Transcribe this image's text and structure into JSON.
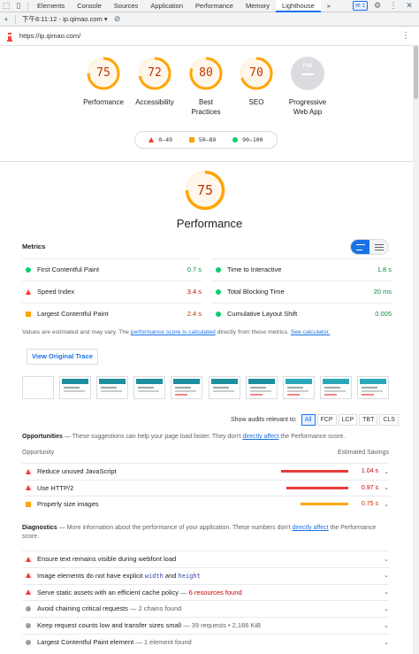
{
  "devtools": {
    "tabs": [
      "Elements",
      "Console",
      "Sources",
      "Application",
      "Performance",
      "Memory",
      "Lighthouse"
    ],
    "more": "»",
    "issues_count": "1",
    "report_selector": "下午8:11:12 - ip.qimao.com",
    "url": "https://ip.qimao.com/"
  },
  "categories": [
    {
      "score": "75",
      "label": "Performance",
      "fraction": 0.75,
      "color": "#ffa400"
    },
    {
      "score": "72",
      "label": "Accessibility",
      "fraction": 0.72,
      "color": "#ffa400"
    },
    {
      "score": "80",
      "label": "Best Practices",
      "fraction": 0.8,
      "color": "#ffa400"
    },
    {
      "score": "70",
      "label": "SEO",
      "fraction": 0.7,
      "color": "#ffa400"
    },
    {
      "score": "PWA",
      "label": "Progressive Web App",
      "fraction": 0,
      "color": "#bdbdbd"
    }
  ],
  "legend": {
    "fail": "0–49",
    "average": "50–89",
    "pass": "90–100"
  },
  "performance": {
    "score": "75",
    "fraction": 0.75,
    "title": "Performance"
  },
  "metrics_label": "Metrics",
  "metrics": [
    {
      "name": "First Contentful Paint",
      "value": "0.7 s",
      "status": "pass"
    },
    {
      "name": "Time to Interactive",
      "value": "1.8 s",
      "status": "pass"
    },
    {
      "name": "Speed Index",
      "value": "3.4 s",
      "status": "fail"
    },
    {
      "name": "Total Blocking Time",
      "value": "20 ms",
      "status": "pass"
    },
    {
      "name": "Largest Contentful Paint",
      "value": "2.4 s",
      "status": "average"
    },
    {
      "name": "Cumulative Layout Shift",
      "value": "0.005",
      "status": "pass"
    }
  ],
  "note": {
    "prefix": "Values are estimated and may vary. The ",
    "link1": "performance score is calculated",
    "middle": " directly from these metrics. ",
    "link2": "See calculator."
  },
  "view_trace": "View Original Trace",
  "filter": {
    "label": "Show audits relevant to:",
    "chips": [
      "All",
      "FCP",
      "LCP",
      "TBT",
      "CLS"
    ]
  },
  "opportunities": {
    "title": "Opportunities",
    "desc": " — These suggestions can help your page load faster. They don't ",
    "link": "directly affect",
    "desc2": " the Performance score.",
    "col_left": "Opportunity",
    "col_right": "Estimated Savings",
    "items": [
      {
        "title": "Reduce unused JavaScript",
        "savings": "1.04 s",
        "fraction": 0.95,
        "status": "fail"
      },
      {
        "title": "Use HTTP/2",
        "savings": "0.97 s",
        "fraction": 0.88,
        "status": "fail"
      },
      {
        "title": "Properly size images",
        "savings": "0.75 s",
        "fraction": 0.68,
        "status": "average"
      }
    ]
  },
  "diagnostics": {
    "title": "Diagnostics",
    "desc": " — More information about the performance of your application. These numbers don't ",
    "link": "directly affect",
    "desc2": " the Performance score.",
    "items": [
      {
        "status": "fail",
        "title": "Ensure text remains visible during webfont load"
      },
      {
        "status": "fail",
        "title_a": "Image elements do not have explicit ",
        "code1": "width",
        "and": " and ",
        "code2": "height"
      },
      {
        "status": "fail",
        "title": "Serve static assets with an efficient cache policy",
        "sep": " — ",
        "extra": "6 resources found"
      },
      {
        "status": "info",
        "title": "Avoid chaining critical requests",
        "sep": " — ",
        "extra": "2 chains found"
      },
      {
        "status": "info",
        "title": "Keep request counts low and transfer sizes small",
        "sep": " — ",
        "extra": "39 requests • 2,166 KiB"
      },
      {
        "status": "info",
        "title": "Largest Contentful Paint element",
        "sep": " — ",
        "extra": "1 element found"
      }
    ]
  }
}
